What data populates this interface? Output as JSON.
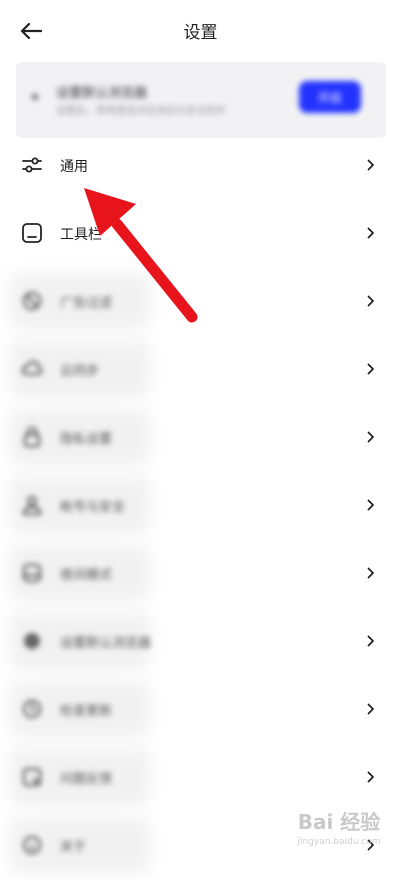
{
  "header": {
    "title": "设置"
  },
  "banner": {
    "title": "设置默认浏览器",
    "subtitle": "设置后，获得更佳浏览体验与安全防护",
    "button_label": "开启"
  },
  "items": [
    {
      "label": "通用",
      "icon": "sliders-icon",
      "blurred": false
    },
    {
      "label": "工具栏",
      "icon": "toolbar-icon",
      "blurred": false
    },
    {
      "label": "广告过滤",
      "icon": "block-icon",
      "blurred": true
    },
    {
      "label": "云同步",
      "icon": "cloud-icon",
      "blurred": true
    },
    {
      "label": "隐私设置",
      "icon": "lock-icon",
      "blurred": true
    },
    {
      "label": "帐号与安全",
      "icon": "user-icon",
      "blurred": true
    },
    {
      "label": "夜间模式",
      "icon": "moon-icon",
      "blurred": true
    },
    {
      "label": "设置默认浏览器",
      "icon": "globe-icon",
      "blurred": true
    },
    {
      "label": "检查更新",
      "icon": "update-icon",
      "blurred": true
    },
    {
      "label": "问题反馈",
      "icon": "feedback-icon",
      "blurred": true
    },
    {
      "label": "关于",
      "icon": "info-icon",
      "blurred": true
    }
  ],
  "watermark": {
    "brand": "Bai 经验",
    "url": "jingyan.baidu.com"
  },
  "colors": {
    "accent": "#2333ff",
    "annotation_arrow": "#e8141c",
    "text": "#222222",
    "banner_bg": "#f2f2f4"
  }
}
